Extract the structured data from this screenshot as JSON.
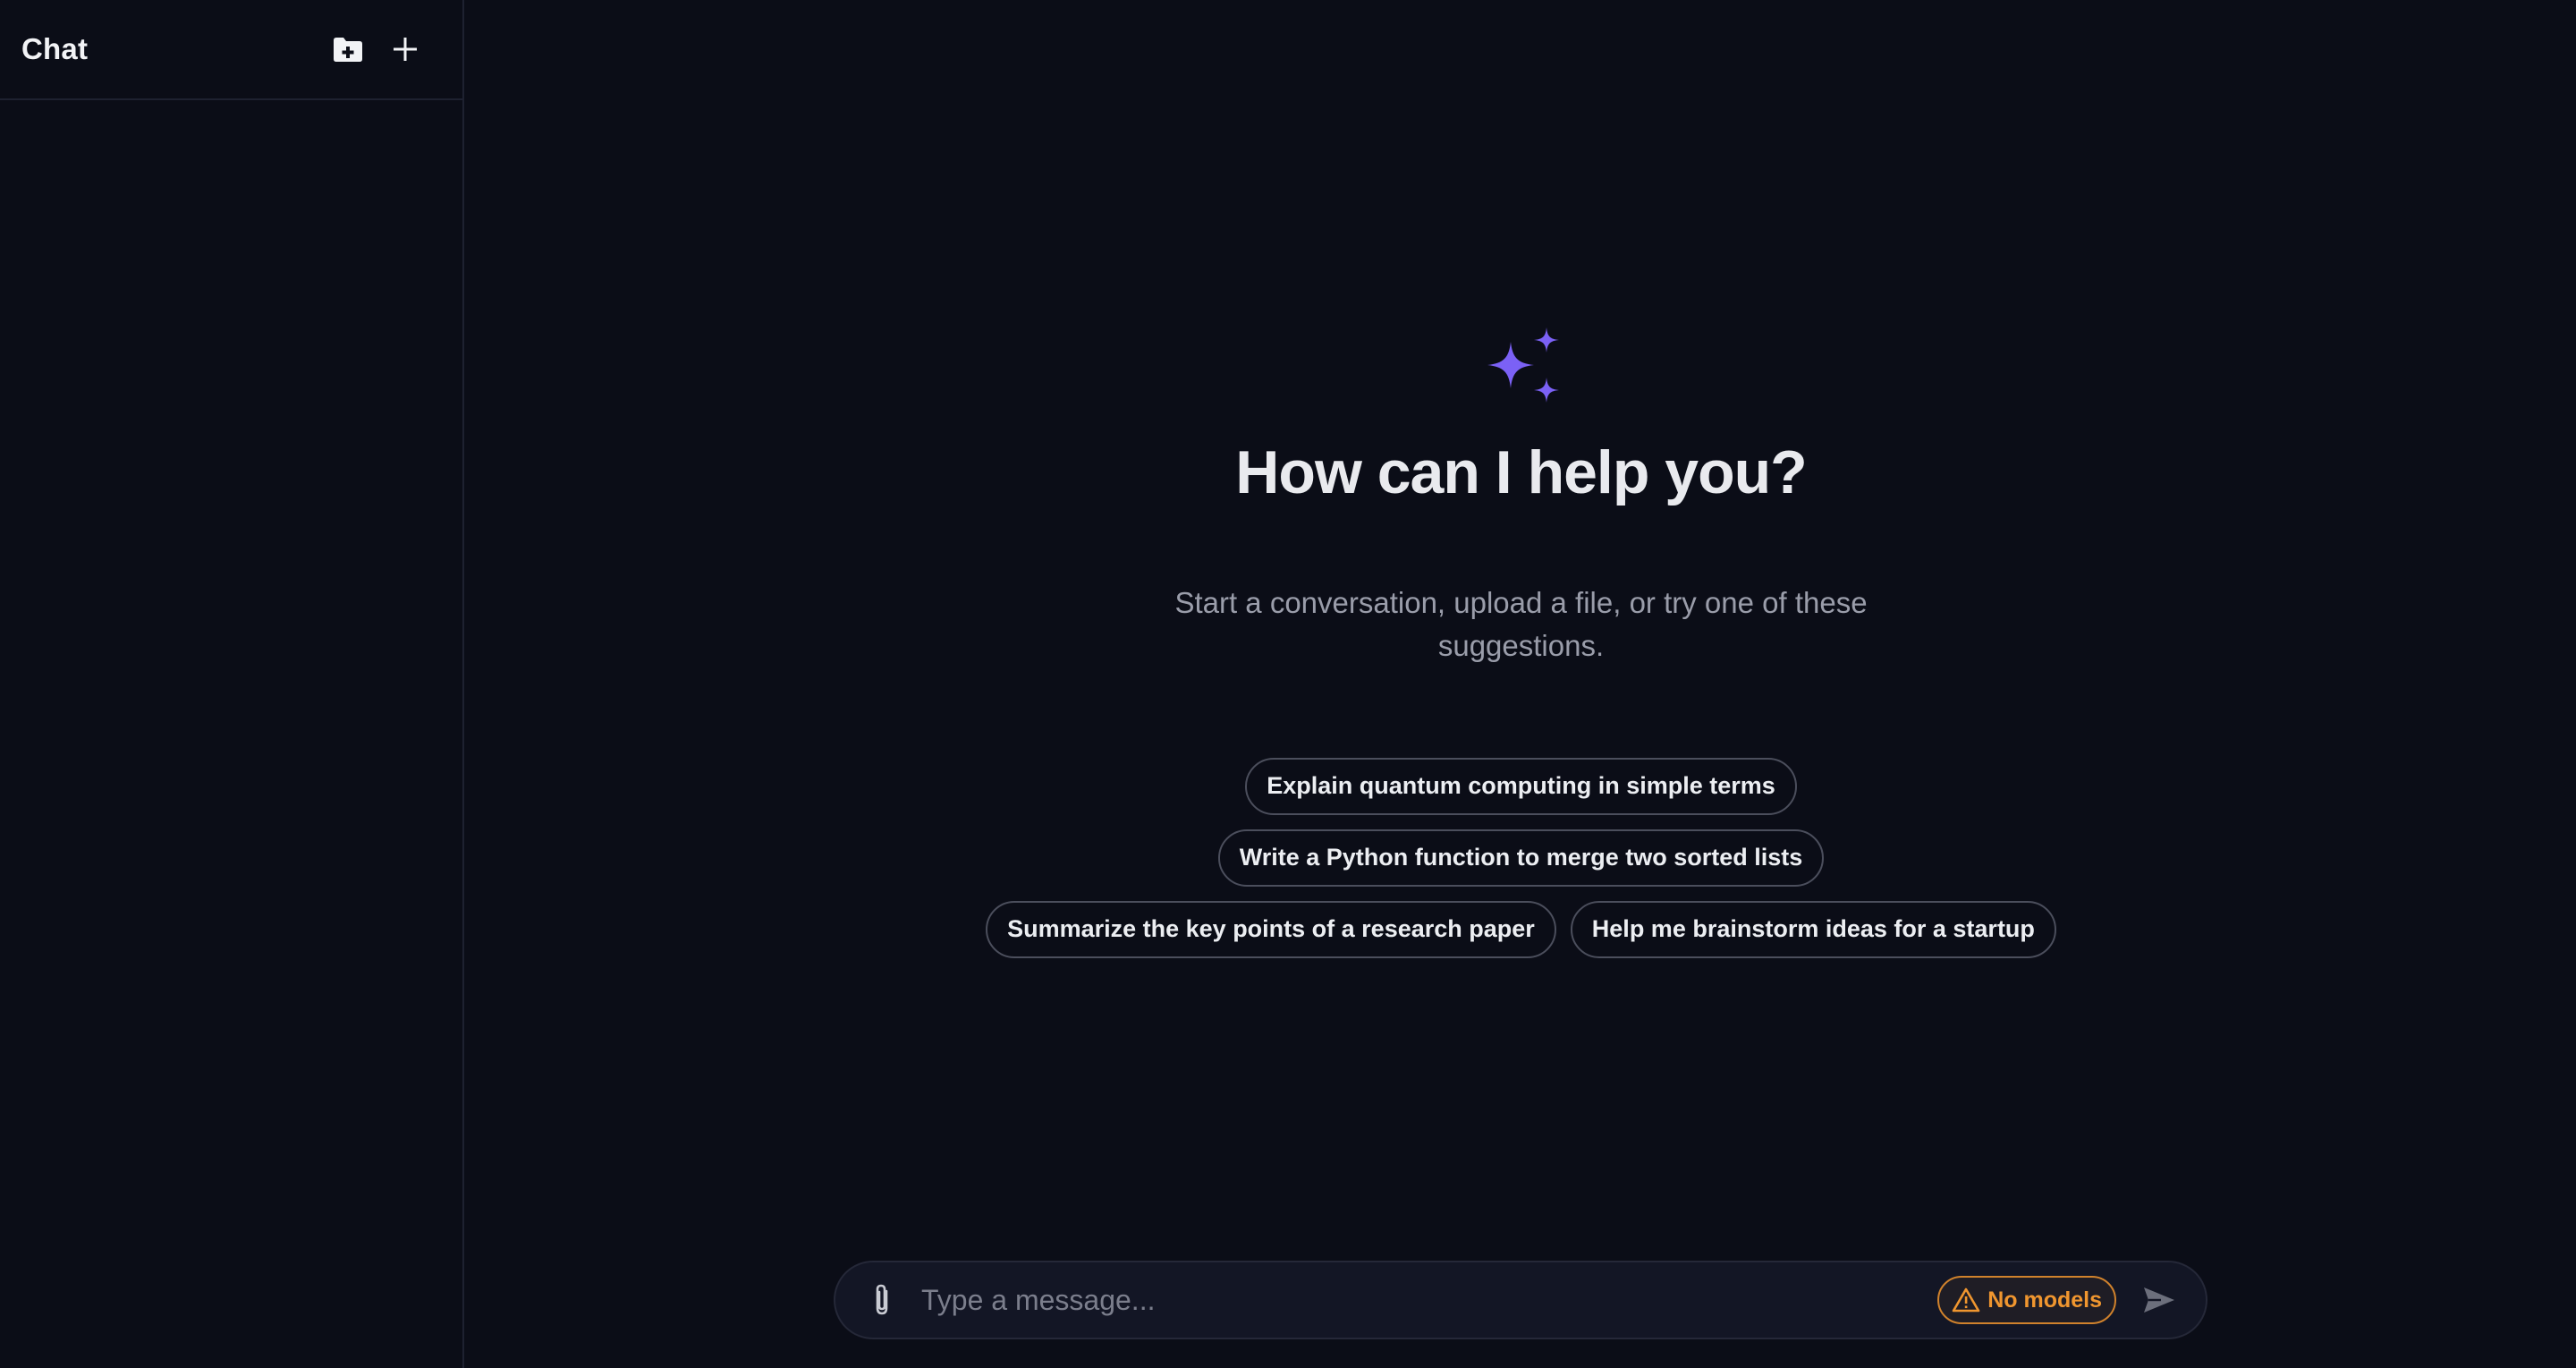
{
  "sidebar": {
    "title": "Chat",
    "new_folder_icon": "folder-plus-icon",
    "new_chat_icon": "plus-icon"
  },
  "hero": {
    "icon": "sparkles-icon",
    "title": "How can I help you?",
    "subtitle": "Start a conversation, upload a file, or try one of these suggestions."
  },
  "suggestions": {
    "rows": [
      [
        "Explain quantum computing in simple terms"
      ],
      [
        "Write a Python function to merge two sorted lists"
      ],
      [
        "Summarize the key points of a research paper",
        "Help me brainstorm ideas for a startup"
      ]
    ]
  },
  "composer": {
    "attach_icon": "paperclip-icon",
    "placeholder": "Type a message...",
    "value": "",
    "model_badge": {
      "icon": "warning-icon",
      "label": "No models"
    },
    "send_icon": "send-icon"
  },
  "colors": {
    "background": "#0b0d17",
    "accent": "#7b61f5",
    "warning": "#f0962f",
    "chip_border": "#4b4e5c"
  }
}
